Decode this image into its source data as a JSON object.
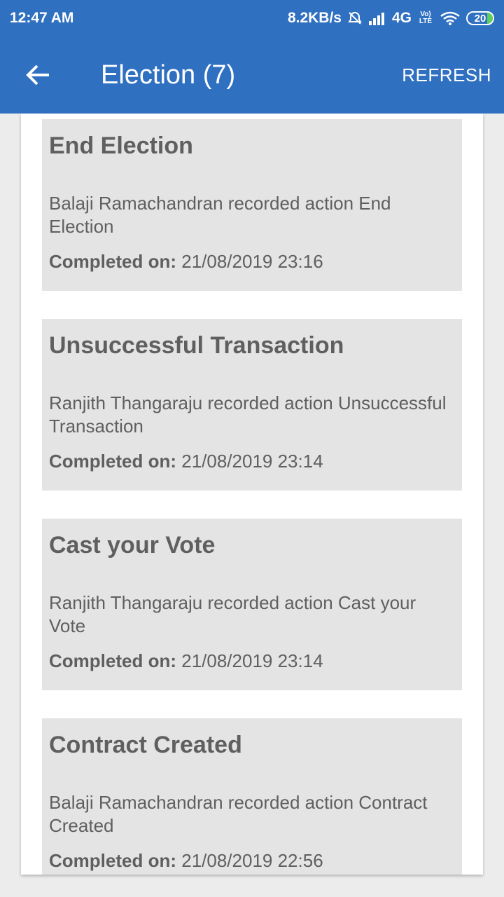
{
  "status_bar": {
    "time": "12:47 AM",
    "speed": "8.2KB/s",
    "network": "4G",
    "volte": "Vo) LTE",
    "battery": "20",
    "icons": [
      "alarm-off-icon",
      "signal-icon",
      "wifi-icon",
      "battery-icon"
    ]
  },
  "app_bar": {
    "back_icon": "arrow-left-icon",
    "title": "Election (7)",
    "refresh_label": "REFRESH"
  },
  "colors": {
    "primary": "#2f70c1",
    "card_bg": "#e4e4e4",
    "text": "#5f5f5f"
  },
  "date_label": "Completed on:",
  "cards": [
    {
      "title": "End Election",
      "description": "Balaji Ramachandran recorded action End Election",
      "completed_on": "21/08/2019 23:16"
    },
    {
      "title": "Unsuccessful Transaction",
      "description": "Ranjith Thangaraju recorded action Unsuccessful Transaction",
      "completed_on": "21/08/2019 23:14"
    },
    {
      "title": "Cast your Vote",
      "description": "Ranjith Thangaraju recorded action Cast your Vote",
      "completed_on": "21/08/2019 23:14"
    },
    {
      "title": "Contract Created",
      "description": "Balaji Ramachandran recorded action Contract Created",
      "completed_on": "21/08/2019 22:56"
    }
  ]
}
